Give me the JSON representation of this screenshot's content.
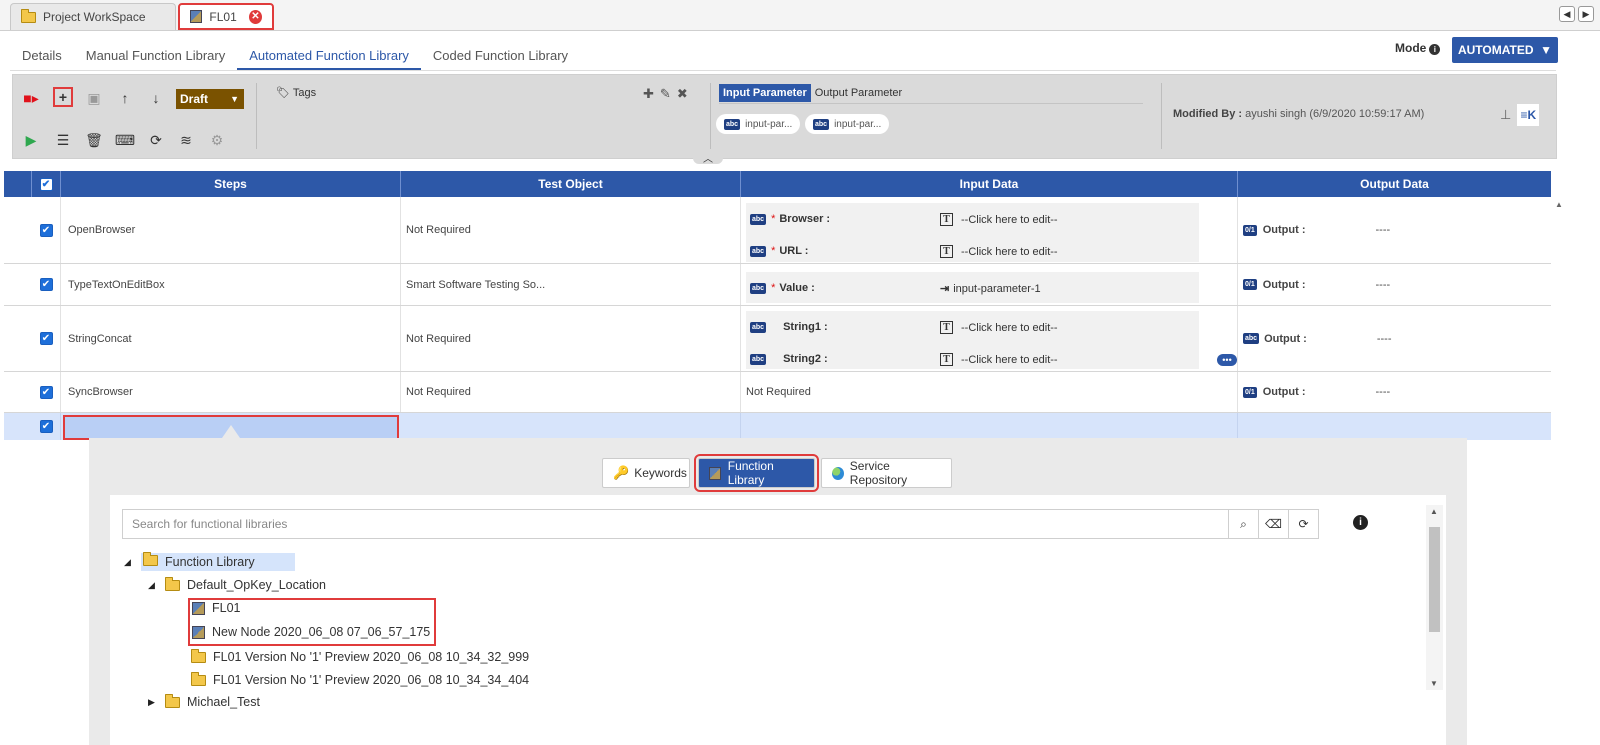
{
  "doc_tabs": [
    {
      "label": "Project WorkSpace"
    },
    {
      "label": "FL01"
    }
  ],
  "section_tabs": [
    {
      "label": "Details"
    },
    {
      "label": "Manual Function Library"
    },
    {
      "label": "Automated Function Library"
    },
    {
      "label": "Coded Function Library"
    }
  ],
  "mode": {
    "label": "Mode",
    "value": "AUTOMATED"
  },
  "toolbar": {
    "status": "Draft",
    "tags_label": "Tags",
    "param_tabs": [
      "Input Parameter",
      "Output Parameter"
    ],
    "chips": [
      "input-par...",
      "input-par..."
    ],
    "modified_label": "Modified By :",
    "modified_value": "ayushi singh (6/9/2020 10:59:17 AM)"
  },
  "grid": {
    "columns": [
      "Steps",
      "Test Object",
      "Input Data",
      "Output Data"
    ],
    "rows": [
      {
        "step": "OpenBrowser",
        "object": "Not Required",
        "inputs": [
          {
            "name": "Browser :",
            "value": "--Click here to edit--"
          },
          {
            "name": "URL :",
            "value": "--Click here to edit--"
          }
        ],
        "output_label": "Output :",
        "output_value": "----"
      },
      {
        "step": "TypeTextOnEditBox",
        "object": "Smart Software Testing So...",
        "inputs": [
          {
            "name": "Value :",
            "value": "input-parameter-1"
          }
        ],
        "output_label": "Output :",
        "output_value": "----"
      },
      {
        "step": "StringConcat",
        "object": "Not Required",
        "inputs": [
          {
            "name": "String1 :",
            "value": "--Click here to edit--"
          },
          {
            "name": "String2 :",
            "value": "--Click here to edit--"
          }
        ],
        "output_label": "Output :",
        "output_value": "----"
      },
      {
        "step": "SyncBrowser",
        "object": "Not Required",
        "input_text": "Not Required",
        "output_label": "Output :",
        "output_value": "----"
      }
    ]
  },
  "picker": {
    "tabs": [
      "Keywords",
      "Function Library",
      "Service Repository"
    ],
    "search_placeholder": "Search for functional libraries",
    "tree": [
      "Function Library",
      "Default_OpKey_Location",
      "FL01",
      "New Node 2020_06_08 07_06_57_175",
      "FL01 Version No '1' Preview 2020_06_08 10_34_32_999",
      "FL01 Version No '1' Preview 2020_06_08 10_34_34_404",
      "Michael_Test"
    ]
  }
}
